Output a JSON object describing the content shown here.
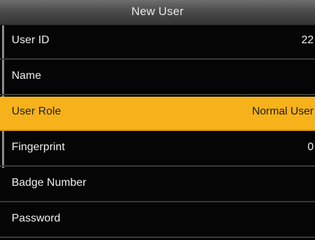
{
  "header": {
    "title": "New User"
  },
  "rows": [
    {
      "label": "User ID",
      "value": "22"
    },
    {
      "label": "Name",
      "value": ""
    },
    {
      "label": "User Role",
      "value": "Normal User"
    },
    {
      "label": "Fingerprint",
      "value": "0"
    },
    {
      "label": "Badge Number",
      "value": ""
    },
    {
      "label": "Password",
      "value": ""
    }
  ],
  "colors": {
    "selected_bg": "#f6b21a",
    "background": "#050505",
    "divider": "#3a3a3a"
  }
}
